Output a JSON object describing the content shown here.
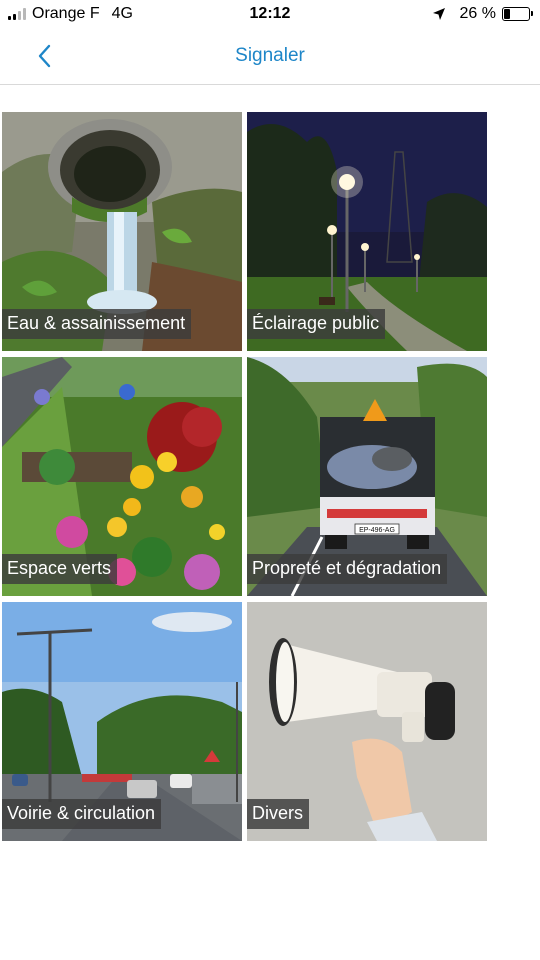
{
  "status_bar": {
    "carrier": "Orange F",
    "network": "4G",
    "time": "12:12",
    "battery": "26 %",
    "battery_level": 0.26
  },
  "nav": {
    "title": "Signaler",
    "back_icon": "chevron-left-icon"
  },
  "accent_color": "#1e86c8",
  "categories": [
    {
      "label": "Eau & assainissement"
    },
    {
      "label": "Éclairage public"
    },
    {
      "label": "Espace verts"
    },
    {
      "label": "Propreté et dégradation"
    },
    {
      "label": "Voirie & circulation"
    },
    {
      "label": "Divers"
    }
  ],
  "truck_plate": "EP-496-AG"
}
